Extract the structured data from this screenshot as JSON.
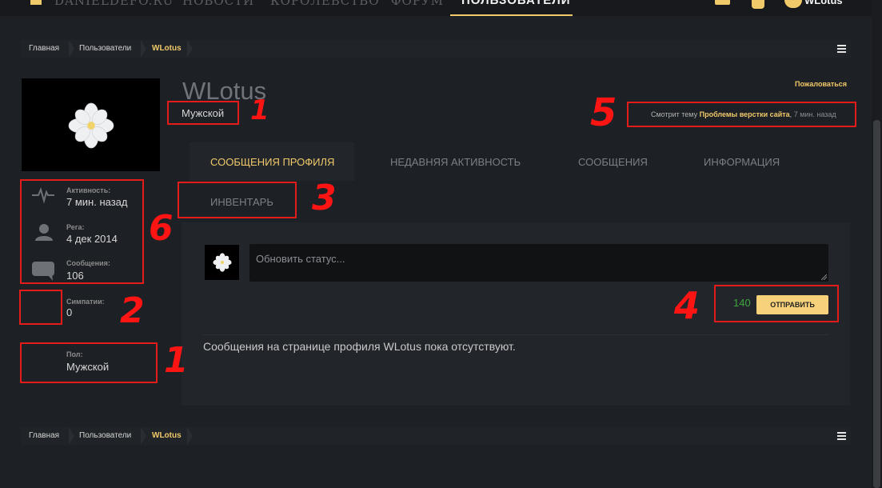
{
  "nav": {
    "items": [
      "DANIELDEFO.RU",
      "НОВОСТИ",
      "КОРОЛЕВСТВО",
      "ФОРУМ",
      "ПОЛЬЗОВАТЕЛИ"
    ],
    "user": "WLotus"
  },
  "breadcrumb": [
    "Главная",
    "Пользователи",
    "WLotus"
  ],
  "profile": {
    "username": "WLotus",
    "gender_badge": "Мужской",
    "report": "Пожаловаться",
    "viewing_prefix": "Смотрит тему",
    "viewing_topic": "Проблемы верстки сайта",
    "viewing_time": "7 мин. назад"
  },
  "stats": {
    "activity_label": "Активность:",
    "activity_value": "7 мин. назад",
    "reg_label": "Рега:",
    "reg_value": "4 дек 2014",
    "messages_label": "Сообщения:",
    "messages_value": "106",
    "likes_label": "Симпатии:",
    "likes_value": "0",
    "gender_label": "Пол:",
    "gender_value": "Мужской"
  },
  "tabs": [
    "СООБЩЕНИЯ ПРОФИЛЯ",
    "НЕДАВНЯЯ АКТИВНОСТЬ",
    "СООБЩЕНИЯ",
    "ИНФОРМАЦИЯ",
    "ИНВЕНТАРЬ"
  ],
  "status": {
    "placeholder": "Обновить статус...",
    "char_count": "140",
    "send_label": "ОТПРАВИТЬ",
    "empty_message": "Сообщения на странице профиля WLotus пока отсутствуют."
  },
  "annotations": [
    "1",
    "5",
    "3",
    "6",
    "2",
    "1",
    "4"
  ],
  "colors": {
    "accent": "#f0c96a",
    "annotation": "#e21b1b",
    "counter": "#3ea83e"
  }
}
